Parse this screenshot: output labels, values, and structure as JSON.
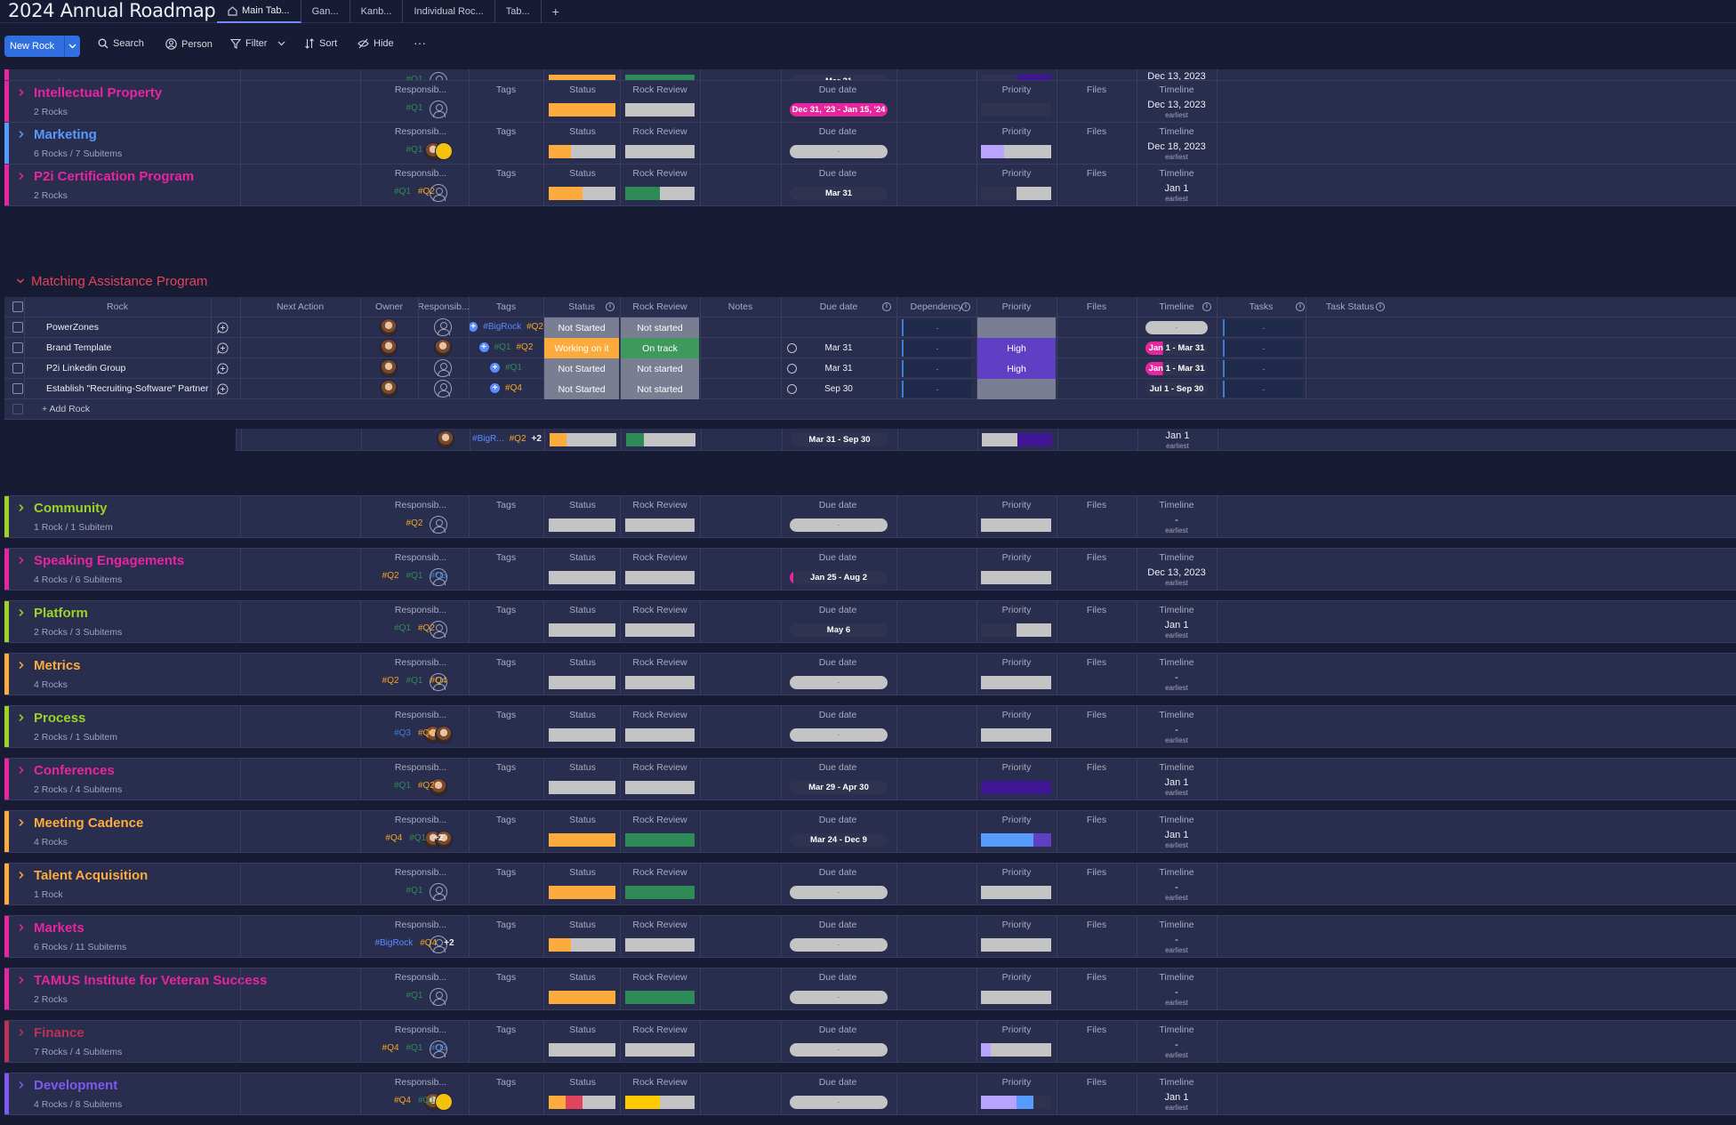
{
  "app": {
    "title": "2024 Annual Roadmap",
    "tabs": [
      "Main Tab...",
      "Gan...",
      "Kanb...",
      "Individual Roc...",
      "Tab..."
    ],
    "add_tab": "+"
  },
  "toolbar": {
    "new_label": "New Rock",
    "search": "Search",
    "person": "Person",
    "filter": "Filter",
    "sort": "Sort",
    "hide": "Hide",
    "more": "···"
  },
  "columns": {
    "responsible": "Responsib...",
    "tags": "Tags",
    "status": "Status",
    "rock_review": "Rock Review",
    "due_date": "Due date",
    "priority": "Priority",
    "files": "Files",
    "timeline": "Timeline",
    "earliest": "earliest"
  },
  "colors": {
    "pink": "#e2445c",
    "hotpink": "#e7259e",
    "blue": "#579bfc",
    "lime": "#9cd326",
    "orange": "#fdab3d",
    "purple": "#7e5af0",
    "green": "#2e8b57",
    "grey": "#c4c4c4",
    "working": "#fdab3d",
    "ontrack": "#3d9a5c",
    "notstarted": "#797e93",
    "high": "#5f3fc4",
    "darkpurple": "#401694"
  },
  "groups_top": [
    {
      "name": "",
      "sub": "2 Rocks",
      "color": "#e7259e",
      "tags": [
        {
          "t": "#Q1",
          "c": "tq1"
        }
      ],
      "status": [
        [
          1,
          "#fdab3d"
        ]
      ],
      "review": [
        [
          1,
          "#2e8b57"
        ]
      ],
      "due": {
        "text": "Mar 31",
        "style": "dark"
      },
      "priority": [
        [
          0.5,
          "#2f3350"
        ],
        [
          0.5,
          "#401694"
        ]
      ],
      "timeline": "Dec 13, 2023",
      "avatars": "person"
    },
    {
      "name": "Intellectual Property",
      "sub": "2 Rocks",
      "color": "#e7259e",
      "tags": [
        {
          "t": "#Q1",
          "c": "tq1"
        }
      ],
      "status": [
        [
          1,
          "#fdab3d"
        ]
      ],
      "review": [
        [
          1,
          "#c4c4c4"
        ]
      ],
      "due": {
        "text": "Dec 31, '23 - Jan 15, '24",
        "style": "pink"
      },
      "priority": [
        [
          1,
          "#2f3350"
        ]
      ],
      "timeline": "Dec 13, 2023",
      "avatars": "person"
    },
    {
      "name": "Marketing",
      "sub": "6 Rocks / 7 Subitems",
      "color": "#579bfc",
      "tags": [
        {
          "t": "#Q1",
          "c": "tq1"
        }
      ],
      "status": [
        [
          0.33,
          "#fdab3d"
        ],
        [
          0.67,
          "#c4c4c4"
        ]
      ],
      "review": [
        [
          1,
          "#c4c4c4"
        ]
      ],
      "due": {
        "text": "-",
        "style": "grey"
      },
      "priority": [
        [
          0.33,
          "#b8a4ff"
        ],
        [
          0.67,
          "#c4c4c4"
        ]
      ],
      "timeline": "Dec 18, 2023",
      "avatars": "faces"
    },
    {
      "name": "P2i Certification Program",
      "sub": "2 Rocks",
      "color": "#e7259e",
      "tags": [
        {
          "t": "#Q1",
          "c": "tq1"
        },
        {
          "t": "#Q2",
          "c": "tq2"
        }
      ],
      "status": [
        [
          0.5,
          "#fdab3d"
        ],
        [
          0.5,
          "#c4c4c4"
        ]
      ],
      "review": [
        [
          0.5,
          "#2e8b57"
        ],
        [
          0.5,
          "#c4c4c4"
        ]
      ],
      "due": {
        "text": "Mar 31",
        "style": "dark"
      },
      "priority": [
        [
          0.5,
          "#2f3350"
        ],
        [
          0.5,
          "#c4c4c4"
        ]
      ],
      "timeline": "Jan 1",
      "avatars": "person"
    }
  ],
  "expanded": {
    "title": "Matching Assistance Program",
    "headers": {
      "rock": "Rock",
      "next_action": "Next Action",
      "owner": "Owner",
      "responsible": "Responsib...",
      "tags": "Tags",
      "status": "Status",
      "rock_review": "Rock Review",
      "notes": "Notes",
      "due_date": "Due date",
      "dependency": "Dependency",
      "priority": "Priority",
      "files": "Files",
      "timeline": "Timeline",
      "tasks": "Tasks",
      "task_status": "Task Status"
    },
    "rows": [
      {
        "name": "PowerZones",
        "tags": [
          {
            "t": "#BigRock",
            "c": "tbig"
          },
          {
            "t": "#Q2",
            "c": "tq2"
          }
        ],
        "status": "Not Started",
        "status_color": "#797e93",
        "review": "Not started",
        "review_color": "#797e93",
        "due": "",
        "circle": false,
        "priority": "",
        "priority_color": "#797e93",
        "timeline": "-",
        "timeline_style": "grey",
        "dep": "-",
        "task": "-"
      },
      {
        "name": "Brand Template",
        "tags": [
          {
            "t": "#Q1",
            "c": "tq1"
          },
          {
            "t": "#Q2",
            "c": "tq2"
          }
        ],
        "status": "Working on it",
        "status_color": "#fdab3d",
        "review": "On track",
        "review_color": "#3d9a5c",
        "due": "Mar 31",
        "circle": true,
        "priority": "High",
        "priority_color": "#5f3fc4",
        "timeline": "Jan 1 - Mar 31",
        "timeline_style": "pink",
        "dep": "-",
        "task": "-"
      },
      {
        "name": "P2i Linkedin Group",
        "tags": [
          {
            "t": "#Q1",
            "c": "tq1"
          }
        ],
        "status": "Not Started",
        "status_color": "#797e93",
        "review": "Not started",
        "review_color": "#797e93",
        "due": "Mar 31",
        "circle": true,
        "priority": "High",
        "priority_color": "#5f3fc4",
        "timeline": "Jan 1 - Mar 31",
        "timeline_style": "pink",
        "dep": "-",
        "task": "-"
      },
      {
        "name": "Establish \"Recruiting-Software\" Partner",
        "tags": [
          {
            "t": "#Q4",
            "c": "tq4"
          }
        ],
        "status": "Not Started",
        "status_color": "#797e93",
        "review": "Not started",
        "review_color": "#797e93",
        "due": "Sep 30",
        "circle": true,
        "priority": "",
        "priority_color": "#797e93",
        "timeline": "Jul 1 - Sep 30",
        "timeline_style": "dark",
        "dep": "-",
        "task": "-"
      }
    ],
    "add_label": "+ Add Rock",
    "summary": {
      "tags": [
        {
          "t": "#BigR...",
          "c": "tbig"
        },
        {
          "t": "#Q2",
          "c": "tq2"
        },
        {
          "t": "+2",
          "c": "tplus"
        }
      ],
      "due": "Mar 31 - Sep 30",
      "timeline": "Jan 1",
      "earliest": "earliest"
    }
  },
  "groups_bottom": [
    {
      "name": "Community",
      "sub": "1 Rock / 1 Subitem",
      "color": "#9cd326",
      "tags": [
        {
          "t": "#Q2",
          "c": "tq2"
        }
      ],
      "status": [
        [
          1,
          "#c4c4c4"
        ]
      ],
      "review": [
        [
          1,
          "#c4c4c4"
        ]
      ],
      "due": {
        "text": "-",
        "style": "grey"
      },
      "priority": [
        [
          1,
          "#c4c4c4"
        ]
      ],
      "timeline": "-",
      "avatars": "person"
    },
    {
      "name": "Speaking Engagements",
      "sub": "4 Rocks / 6 Subitems",
      "color": "#e7259e",
      "tags": [
        {
          "t": "#Q2",
          "c": "tq2"
        },
        {
          "t": "#Q1",
          "c": "tq1"
        },
        {
          "t": "#Q3",
          "c": "tq3"
        }
      ],
      "status": [
        [
          1,
          "#c4c4c4"
        ]
      ],
      "review": [
        [
          1,
          "#c4c4c4"
        ]
      ],
      "due": {
        "text": "Jan 25 - Aug 2",
        "style": "darkpink"
      },
      "priority": [
        [
          1,
          "#c4c4c4"
        ]
      ],
      "timeline": "Dec 13, 2023",
      "avatars": "person"
    },
    {
      "name": "Platform",
      "sub": "2 Rocks / 3 Subitems",
      "color": "#9cd326",
      "tags": [
        {
          "t": "#Q1",
          "c": "tq1"
        },
        {
          "t": "#Q2",
          "c": "tq2"
        }
      ],
      "status": [
        [
          1,
          "#c4c4c4"
        ]
      ],
      "review": [
        [
          1,
          "#c4c4c4"
        ]
      ],
      "due": {
        "text": "May 6",
        "style": "dark"
      },
      "priority": [
        [
          0.5,
          "#2f3350"
        ],
        [
          0.5,
          "#c4c4c4"
        ]
      ],
      "timeline": "Jan 1",
      "avatars": "person"
    },
    {
      "name": "Metrics",
      "sub": "4 Rocks",
      "color": "#fdab3d",
      "tags": [
        {
          "t": "#Q2",
          "c": "tq2"
        },
        {
          "t": "#Q1",
          "c": "tq1"
        },
        {
          "t": "#Q4",
          "c": "tq4"
        }
      ],
      "status": [
        [
          1,
          "#c4c4c4"
        ]
      ],
      "review": [
        [
          1,
          "#c4c4c4"
        ]
      ],
      "due": {
        "text": "-",
        "style": "grey"
      },
      "priority": [
        [
          1,
          "#c4c4c4"
        ]
      ],
      "timeline": "-",
      "avatars": "person"
    },
    {
      "name": "Process",
      "sub": "2 Rocks / 1 Subitem",
      "color": "#9cd326",
      "tags": [
        {
          "t": "#Q3",
          "c": "tq3"
        },
        {
          "t": "#Q2",
          "c": "tq2"
        }
      ],
      "status": [
        [
          1,
          "#c4c4c4"
        ]
      ],
      "review": [
        [
          1,
          "#c4c4c4"
        ]
      ],
      "due": {
        "text": "-",
        "style": "grey"
      },
      "priority": [
        [
          1,
          "#c4c4c4"
        ]
      ],
      "timeline": "-",
      "avatars": "faces2"
    },
    {
      "name": "Conferences",
      "sub": "2 Rocks / 4 Subitems",
      "color": "#e7259e",
      "tags": [
        {
          "t": "#Q1",
          "c": "tq1"
        },
        {
          "t": "#Q2",
          "c": "tq2"
        }
      ],
      "status": [
        [
          1,
          "#c4c4c4"
        ]
      ],
      "review": [
        [
          1,
          "#c4c4c4"
        ]
      ],
      "due": {
        "text": "Mar 29 - Apr 30",
        "style": "dark"
      },
      "priority": [
        [
          1,
          "#401694"
        ]
      ],
      "timeline": "Jan 1",
      "avatars": "face"
    },
    {
      "name": "Meeting Cadence",
      "sub": "4 Rocks",
      "color": "#fdab3d",
      "tags": [
        {
          "t": "#Q4",
          "c": "tq4"
        },
        {
          "t": "#Q1",
          "c": "tq1"
        },
        {
          "t": "+2",
          "c": "tplus"
        }
      ],
      "status": [
        [
          1,
          "#fdab3d"
        ]
      ],
      "review": [
        [
          1,
          "#2e8b57"
        ]
      ],
      "due": {
        "text": "Mar 24 - Dec 9",
        "style": "dark"
      },
      "priority": [
        [
          0.75,
          "#579bfc"
        ],
        [
          0.25,
          "#5f3fc4"
        ]
      ],
      "timeline": "Jan 1",
      "avatars": "faces2"
    },
    {
      "name": "Talent Acquisition",
      "sub": "1 Rock",
      "color": "#fdab3d",
      "tags": [
        {
          "t": "#Q1",
          "c": "tq1"
        }
      ],
      "status": [
        [
          1,
          "#fdab3d"
        ]
      ],
      "review": [
        [
          1,
          "#2e8b57"
        ]
      ],
      "due": {
        "text": "-",
        "style": "grey"
      },
      "priority": [
        [
          1,
          "#c4c4c4"
        ]
      ],
      "timeline": "-",
      "avatars": "person"
    },
    {
      "name": "Markets",
      "sub": "6 Rocks / 11 Subitems",
      "color": "#e7259e",
      "tags": [
        {
          "t": "#BigRock",
          "c": "tbig"
        },
        {
          "t": "#Q4",
          "c": "tq4"
        },
        {
          "t": "+2",
          "c": "tplus"
        }
      ],
      "status": [
        [
          0.33,
          "#fdab3d"
        ],
        [
          0.67,
          "#c4c4c4"
        ]
      ],
      "review": [
        [
          1,
          "#c4c4c4"
        ]
      ],
      "due": {
        "text": "-",
        "style": "grey"
      },
      "priority": [
        [
          1,
          "#c4c4c4"
        ]
      ],
      "timeline": "-",
      "avatars": "person"
    },
    {
      "name": "TAMUS Institute for Veteran Success",
      "sub": "2 Rocks",
      "color": "#e7259e",
      "tags": [
        {
          "t": "#Q1",
          "c": "tq1"
        }
      ],
      "status": [
        [
          1,
          "#fdab3d"
        ]
      ],
      "review": [
        [
          1,
          "#2e8b57"
        ]
      ],
      "due": {
        "text": "-",
        "style": "grey"
      },
      "priority": [
        [
          1,
          "#c4c4c4"
        ]
      ],
      "timeline": "-",
      "avatars": "person"
    },
    {
      "name": "Finance",
      "sub": "7 Rocks / 4 Subitems",
      "color": "#bb3354",
      "tags": [
        {
          "t": "#Q4",
          "c": "tq4"
        },
        {
          "t": "#Q1",
          "c": "tq1"
        },
        {
          "t": "#Q3",
          "c": "tq3"
        }
      ],
      "status": [
        [
          1,
          "#c4c4c4"
        ]
      ],
      "review": [
        [
          1,
          "#c4c4c4"
        ]
      ],
      "due": {
        "text": "-",
        "style": "grey"
      },
      "priority": [
        [
          0.14,
          "#b8a4ff"
        ],
        [
          0.86,
          "#c4c4c4"
        ]
      ],
      "timeline": "-",
      "avatars": "person"
    },
    {
      "name": "Development",
      "sub": "4 Rocks / 8 Subitems",
      "color": "#7e5af0",
      "tags": [
        {
          "t": "#Q4",
          "c": "tq4"
        },
        {
          "t": "#Q1",
          "c": "tq1"
        }
      ],
      "status": [
        [
          0.25,
          "#fdab3d"
        ],
        [
          0.25,
          "#e2445c"
        ],
        [
          0.5,
          "#c4c4c4"
        ]
      ],
      "review": [
        [
          0.5,
          "#ffcb00"
        ],
        [
          0.5,
          "#c4c4c4"
        ]
      ],
      "due": {
        "text": "-",
        "style": "grey"
      },
      "priority": [
        [
          0.5,
          "#b8a4ff"
        ],
        [
          0.25,
          "#579bfc"
        ],
        [
          0.25,
          "#2f3350"
        ]
      ],
      "timeline": "Jan 1",
      "avatars": "faces"
    }
  ]
}
